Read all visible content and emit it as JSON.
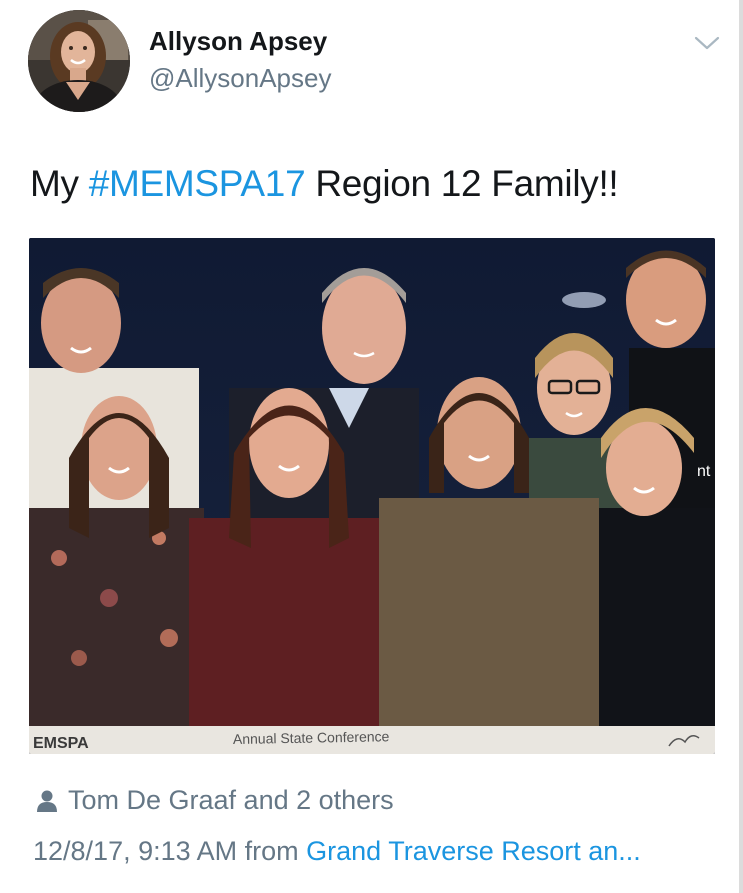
{
  "author": {
    "name": "Allyson Apsey",
    "handle": "@AllysonApsey"
  },
  "tweet": {
    "text_before": "My ",
    "hashtag": "#MEMSPA17",
    "text_after": " Region 12 Family!!"
  },
  "photo": {
    "banner_left": "EMSPA",
    "banner_middle": "Annual State Conference",
    "jacket_text": "nt"
  },
  "likes": {
    "icon": "person-icon",
    "text": "Tom De Graaf and 2 others"
  },
  "meta": {
    "timestamp": "12/8/17, 9:13 AM from ",
    "source": "Grand Traverse Resort an..."
  },
  "colors": {
    "link": "#1b95e0",
    "secondary": "#657786",
    "primary": "#14171a"
  }
}
